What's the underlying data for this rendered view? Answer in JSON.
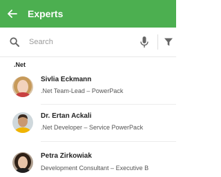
{
  "appbar": {
    "title": "Experts",
    "back_icon": "arrow-left-icon",
    "color": "#4caf50"
  },
  "search": {
    "placeholder": "Search",
    "value": ""
  },
  "section": {
    "label": ".Net"
  },
  "experts": [
    {
      "name": "Sivlia Eckmann",
      "role": ".Net Team-Lead – PowerPack"
    },
    {
      "name": "Dr. Ertan Ackali",
      "role": ".Net Developer –  Service PowerPack"
    },
    {
      "name": "Petra Zirkowiak",
      "role": "Development Consultant – Executive B"
    }
  ]
}
